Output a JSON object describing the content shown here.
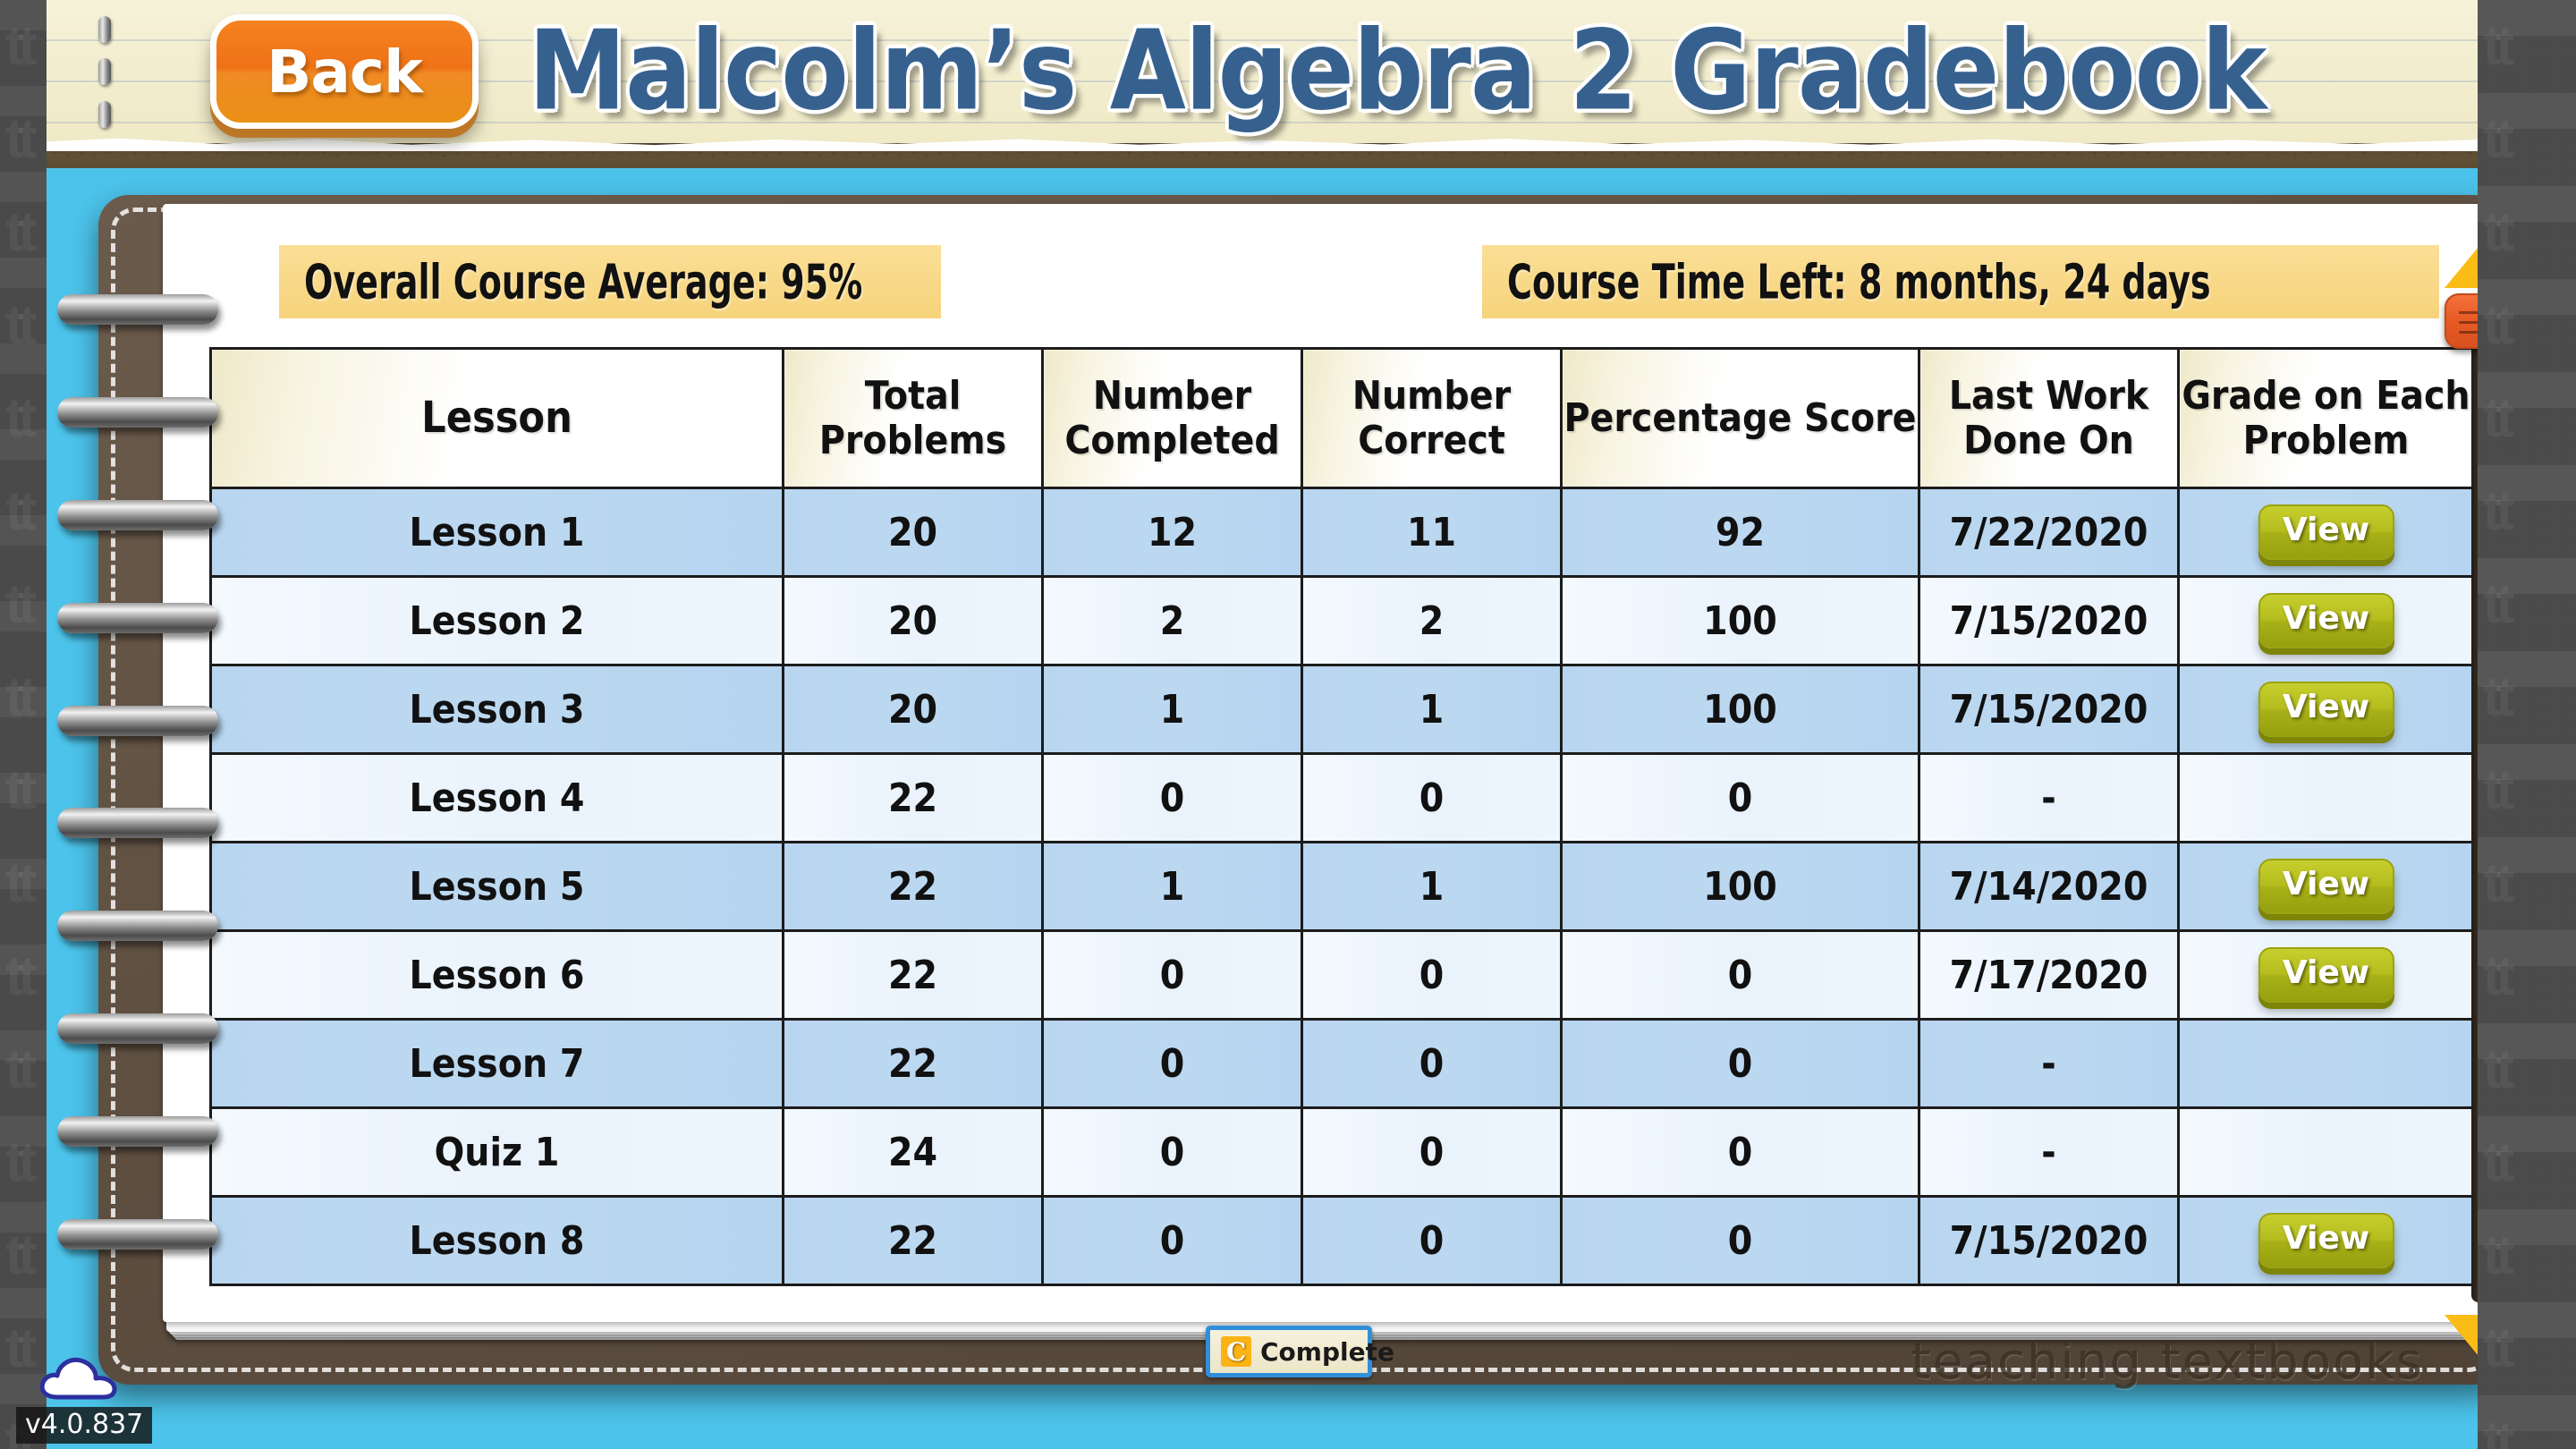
{
  "header": {
    "back_label": "Back",
    "title": "Malcolm’s Algebra 2 Gradebook"
  },
  "banners": {
    "average_label": "Overall Course Average:  95%",
    "time_left_label": "Course Time Left:   8 months, 24 days"
  },
  "table": {
    "columns": [
      "Lesson",
      "Total Problems",
      "Number Completed",
      "Number Correct",
      "Percentage Score",
      "Last Work Done On",
      "Grade on Each Problem"
    ],
    "view_label": "View",
    "rows": [
      {
        "lesson": "Lesson 1",
        "total": "20",
        "completed": "12",
        "correct": "11",
        "percentage": "92",
        "last_work": "7/22/2020",
        "has_view": true
      },
      {
        "lesson": "Lesson 2",
        "total": "20",
        "completed": "2",
        "correct": "2",
        "percentage": "100",
        "last_work": "7/15/2020",
        "has_view": true
      },
      {
        "lesson": "Lesson 3",
        "total": "20",
        "completed": "1",
        "correct": "1",
        "percentage": "100",
        "last_work": "7/15/2020",
        "has_view": true
      },
      {
        "lesson": "Lesson 4",
        "total": "22",
        "completed": "0",
        "correct": "0",
        "percentage": "0",
        "last_work": "-",
        "has_view": false
      },
      {
        "lesson": "Lesson 5",
        "total": "22",
        "completed": "1",
        "correct": "1",
        "percentage": "100",
        "last_work": "7/14/2020",
        "has_view": true
      },
      {
        "lesson": "Lesson 6",
        "total": "22",
        "completed": "0",
        "correct": "0",
        "percentage": "0",
        "last_work": "7/17/2020",
        "has_view": true
      },
      {
        "lesson": "Lesson 7",
        "total": "22",
        "completed": "0",
        "correct": "0",
        "percentage": "0",
        "last_work": "-",
        "has_view": false
      },
      {
        "lesson": "Quiz 1",
        "total": "24",
        "completed": "0",
        "correct": "0",
        "percentage": "0",
        "last_work": "-",
        "has_view": false
      },
      {
        "lesson": "Lesson 8",
        "total": "22",
        "completed": "0",
        "correct": "0",
        "percentage": "0",
        "last_work": "7/15/2020",
        "has_view": true
      }
    ]
  },
  "footer": {
    "complete_label": "Complete",
    "complete_icon": "C",
    "brand": "teaching textbooks",
    "version": "v4.0.837"
  },
  "scrollbar": {
    "up_icon": "triangle-up-icon",
    "down_icon": "triangle-down-icon"
  },
  "colors": {
    "accent_orange": "#ef7216",
    "title_blue": "#36618f",
    "banner_yellow": "#f6d37c",
    "row_blue": "#b9d6f0",
    "view_green": "#b4bd1e",
    "page_blue": "#4cc3ea",
    "notebook_brown": "#5d4e40"
  }
}
